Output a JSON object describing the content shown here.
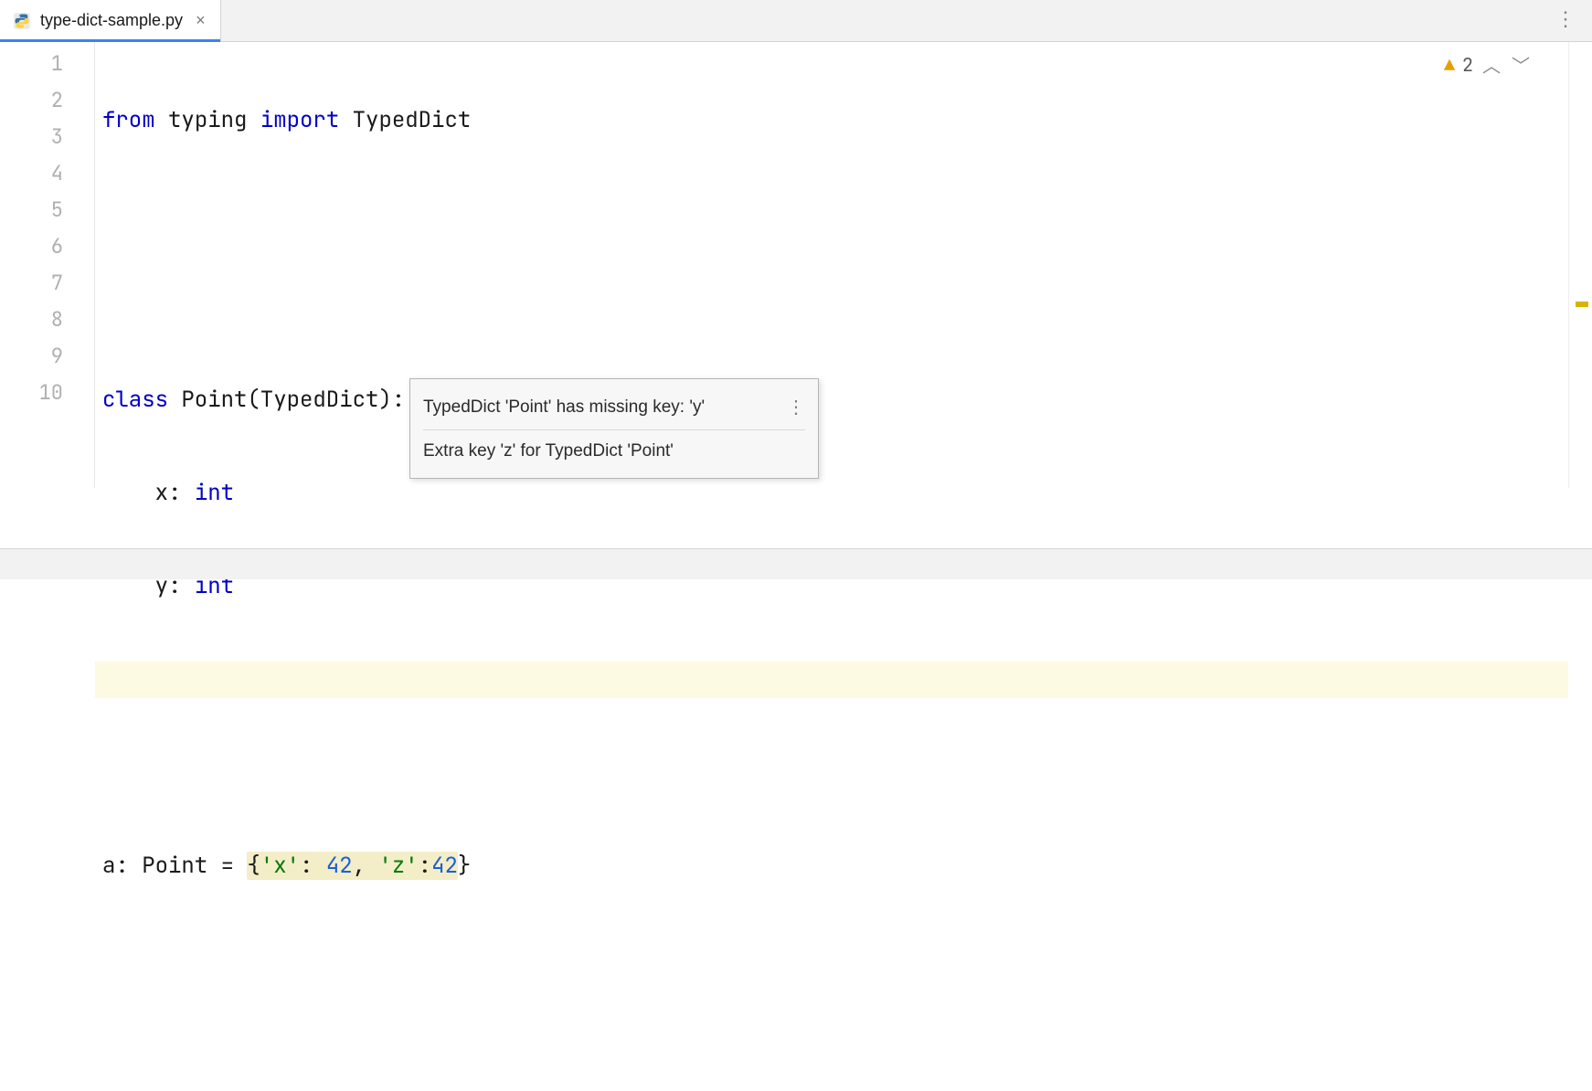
{
  "tab": {
    "filename": "type-dict-sample.py",
    "icon": "python-file-icon"
  },
  "gutter": {
    "lines": [
      "1",
      "2",
      "3",
      "4",
      "5",
      "6",
      "7",
      "8",
      "9",
      "10"
    ]
  },
  "code": {
    "l1": {
      "a": "from",
      "b": "typing",
      "c": "import",
      "d": "TypedDict"
    },
    "l4": {
      "a": "class",
      "b": "Point",
      "c": "(TypedDict):"
    },
    "l5": {
      "a": "    x: ",
      "b": "int"
    },
    "l6": {
      "a": "    y: ",
      "b": "int"
    },
    "l9": {
      "a": "a: Point = ",
      "b": "{",
      "c": "'x'",
      "d": ": ",
      "e": "42",
      "f": ", ",
      "g": "'z'",
      "h": ":",
      "i": "42",
      "j": "}"
    }
  },
  "inspection": {
    "count": "2"
  },
  "tooltip": {
    "line1": "TypedDict 'Point' has missing key: 'y'",
    "line2": "Extra key 'z' for TypedDict 'Point'"
  }
}
